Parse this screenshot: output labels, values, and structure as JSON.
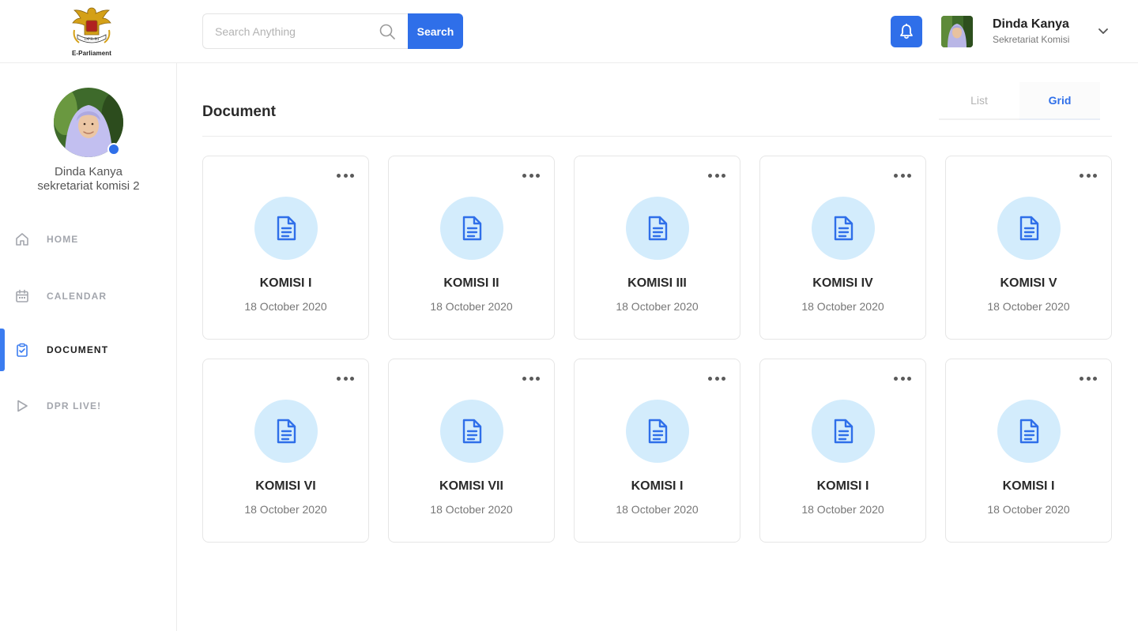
{
  "brand": {
    "logo_text": "E-Parliament",
    "accent": "#2f6fe9"
  },
  "search": {
    "placeholder": "Search Anything",
    "button_label": "Search"
  },
  "user": {
    "name": "Dinda Kanya",
    "role": "Sekretariat Komisi"
  },
  "sidebar": {
    "profile_name": "Dinda Kanya",
    "profile_role": "sekretariat komisi 2",
    "items": [
      {
        "label": "HOME",
        "icon": "home-icon",
        "active": false
      },
      {
        "label": "CALENDAR",
        "icon": "calendar-icon",
        "active": false
      },
      {
        "label": "DOCUMENT",
        "icon": "clipboard-icon",
        "active": true
      },
      {
        "label": "DPR LIVE!",
        "icon": "play-icon",
        "active": false
      }
    ]
  },
  "main": {
    "title": "Document",
    "view_tabs": [
      {
        "label": "List",
        "active": false
      },
      {
        "label": "Grid",
        "active": true
      }
    ],
    "documents": [
      {
        "title": "KOMISI I",
        "date": "18 October 2020"
      },
      {
        "title": "KOMISI II",
        "date": "18 October 2020"
      },
      {
        "title": "KOMISI III",
        "date": "18 October 2020"
      },
      {
        "title": "KOMISI IV",
        "date": "18 October 2020"
      },
      {
        "title": "KOMISI V",
        "date": "18 October 2020"
      },
      {
        "title": "KOMISI VI",
        "date": "18 October 2020"
      },
      {
        "title": "KOMISI VII",
        "date": "18 October 2020"
      },
      {
        "title": "KOMISI I",
        "date": "18 October 2020"
      },
      {
        "title": "KOMISI I",
        "date": "18 October 2020"
      },
      {
        "title": "KOMISI I",
        "date": "18 October 2020"
      }
    ]
  }
}
